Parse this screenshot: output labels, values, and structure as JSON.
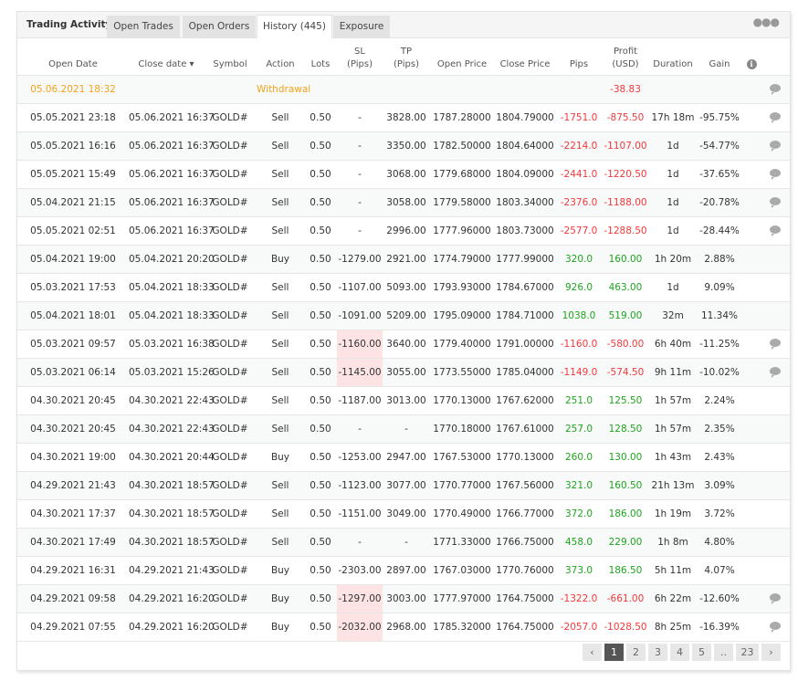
{
  "title": "Trading Activity",
  "tabs": [
    {
      "label": "Open Trades"
    },
    {
      "label": "Open Orders"
    },
    {
      "label": "History (445)",
      "active": true
    },
    {
      "label": "Exposure"
    }
  ],
  "headers": {
    "open_date": "Open Date",
    "close_date": "Close date ▾",
    "symbol": "Symbol",
    "action": "Action",
    "lots": "Lots",
    "sl1": "SL",
    "sl2": "(Pips)",
    "tp1": "TP",
    "tp2": "(Pips)",
    "open_price": "Open Price",
    "close_price": "Close Price",
    "pips": "Pips",
    "profit1": "Profit",
    "profit2": "(USD)",
    "duration": "Duration",
    "gain": "Gain"
  },
  "withdrawal": {
    "date": "05.06.2021 18:32",
    "action": "Withdrawal",
    "profit": "-38.83"
  },
  "rows": [
    [
      "05.05.2021 23:18",
      "05.06.2021 16:37",
      "GOLD#",
      "Sell",
      "0.50",
      "-",
      "3828.00",
      "1787.28000",
      "1804.79000",
      "-1751.0",
      "-875.50",
      "17h 18m",
      "-95.75%",
      0,
      1
    ],
    [
      "05.05.2021 16:16",
      "05.06.2021 16:37",
      "GOLD#",
      "Sell",
      "0.50",
      "-",
      "3350.00",
      "1782.50000",
      "1804.64000",
      "-2214.0",
      "-1107.00",
      "1d",
      "-54.77%",
      0,
      1
    ],
    [
      "05.05.2021 15:49",
      "05.06.2021 16:37",
      "GOLD#",
      "Sell",
      "0.50",
      "-",
      "3068.00",
      "1779.68000",
      "1804.09000",
      "-2441.0",
      "-1220.50",
      "1d",
      "-37.65%",
      0,
      1
    ],
    [
      "05.04.2021 21:15",
      "05.06.2021 16:37",
      "GOLD#",
      "Sell",
      "0.50",
      "-",
      "3058.00",
      "1779.58000",
      "1803.34000",
      "-2376.0",
      "-1188.00",
      "1d",
      "-20.78%",
      0,
      1
    ],
    [
      "05.05.2021 02:51",
      "05.06.2021 16:37",
      "GOLD#",
      "Sell",
      "0.50",
      "-",
      "2996.00",
      "1777.96000",
      "1803.73000",
      "-2577.0",
      "-1288.50",
      "1d",
      "-28.44%",
      0,
      1
    ],
    [
      "05.04.2021 19:00",
      "05.04.2021 20:20",
      "GOLD#",
      "Buy",
      "0.50",
      "-1279.00",
      "2921.00",
      "1774.79000",
      "1777.99000",
      "320.0",
      "160.00",
      "1h 20m",
      "2.88%",
      0,
      0
    ],
    [
      "05.03.2021 17:53",
      "05.04.2021 18:33",
      "GOLD#",
      "Sell",
      "0.50",
      "-1107.00",
      "5093.00",
      "1793.93000",
      "1784.67000",
      "926.0",
      "463.00",
      "1d",
      "9.09%",
      0,
      0
    ],
    [
      "05.04.2021 18:01",
      "05.04.2021 18:33",
      "GOLD#",
      "Sell",
      "0.50",
      "-1091.00",
      "5209.00",
      "1795.09000",
      "1784.71000",
      "1038.0",
      "519.00",
      "32m",
      "11.34%",
      0,
      0
    ],
    [
      "05.03.2021 09:57",
      "05.03.2021 16:38",
      "GOLD#",
      "Sell",
      "0.50",
      "-1160.00",
      "3640.00",
      "1779.40000",
      "1791.00000",
      "-1160.0",
      "-580.00",
      "6h 40m",
      "-11.25%",
      1,
      1
    ],
    [
      "05.03.2021 06:14",
      "05.03.2021 15:26",
      "GOLD#",
      "Sell",
      "0.50",
      "-1145.00",
      "3055.00",
      "1773.55000",
      "1785.04000",
      "-1149.0",
      "-574.50",
      "9h 11m",
      "-10.02%",
      1,
      1
    ],
    [
      "04.30.2021 20:45",
      "04.30.2021 22:43",
      "GOLD#",
      "Sell",
      "0.50",
      "-1187.00",
      "3013.00",
      "1770.13000",
      "1767.62000",
      "251.0",
      "125.50",
      "1h 57m",
      "2.24%",
      0,
      0
    ],
    [
      "04.30.2021 20:45",
      "04.30.2021 22:43",
      "GOLD#",
      "Sell",
      "0.50",
      "-",
      "-",
      "1770.18000",
      "1767.61000",
      "257.0",
      "128.50",
      "1h 57m",
      "2.35%",
      0,
      0
    ],
    [
      "04.30.2021 19:00",
      "04.30.2021 20:44",
      "GOLD#",
      "Buy",
      "0.50",
      "-1253.00",
      "2947.00",
      "1767.53000",
      "1770.13000",
      "260.0",
      "130.00",
      "1h 43m",
      "2.43%",
      0,
      0
    ],
    [
      "04.29.2021 21:43",
      "04.30.2021 18:57",
      "GOLD#",
      "Sell",
      "0.50",
      "-1123.00",
      "3077.00",
      "1770.77000",
      "1767.56000",
      "321.0",
      "160.50",
      "21h 13m",
      "3.09%",
      0,
      0
    ],
    [
      "04.30.2021 17:37",
      "04.30.2021 18:57",
      "GOLD#",
      "Sell",
      "0.50",
      "-1151.00",
      "3049.00",
      "1770.49000",
      "1766.77000",
      "372.0",
      "186.00",
      "1h 19m",
      "3.72%",
      0,
      0
    ],
    [
      "04.30.2021 17:49",
      "04.30.2021 18:57",
      "GOLD#",
      "Sell",
      "0.50",
      "-",
      "-",
      "1771.33000",
      "1766.75000",
      "458.0",
      "229.00",
      "1h 8m",
      "4.80%",
      0,
      0
    ],
    [
      "04.29.2021 16:31",
      "04.29.2021 21:43",
      "GOLD#",
      "Buy",
      "0.50",
      "-2303.00",
      "2897.00",
      "1767.03000",
      "1770.76000",
      "373.0",
      "186.50",
      "5h 11m",
      "4.07%",
      0,
      0
    ],
    [
      "04.29.2021 09:58",
      "04.29.2021 16:20",
      "GOLD#",
      "Buy",
      "0.50",
      "-1297.00",
      "3003.00",
      "1777.97000",
      "1764.75000",
      "-1322.0",
      "-661.00",
      "6h 22m",
      "-12.60%",
      1,
      1
    ],
    [
      "04.29.2021 07:55",
      "04.29.2021 16:20",
      "GOLD#",
      "Buy",
      "0.50",
      "-2032.00",
      "2968.00",
      "1785.32000",
      "1764.75000",
      "-2057.0",
      "-1028.50",
      "8h 25m",
      "-16.39%",
      1,
      1
    ]
  ],
  "pagination": {
    "prev": "‹",
    "pages": [
      "1",
      "2",
      "3",
      "4",
      "5",
      "..",
      "23"
    ],
    "current": "1",
    "next": "›"
  },
  "colors": {
    "negative": "#f2383a",
    "positive": "#1ea51e",
    "withdrawal": "#f5a21b",
    "sl_highlight": "#fde3e3"
  }
}
